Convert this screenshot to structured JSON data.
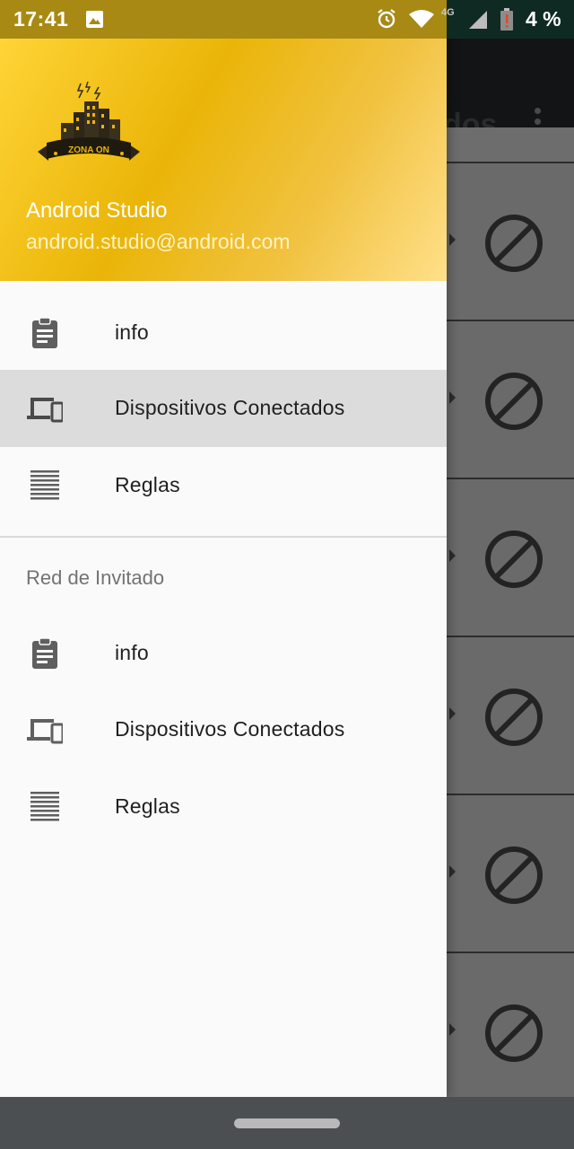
{
  "status_bar": {
    "time": "17:41",
    "network_label": "4G",
    "battery_text": "4 %",
    "icons": [
      "image-icon",
      "alarm-icon",
      "wifi-icon",
      "signal-icon",
      "battery-icon"
    ]
  },
  "background_app": {
    "title_fragment": "dos",
    "row_icon": "block-icon"
  },
  "drawer": {
    "header": {
      "logo_text": "ZONA ON",
      "name": "Android Studio",
      "email": "android.studio@android.com"
    },
    "main_items": [
      {
        "label": "info",
        "icon": "clipboard-icon"
      },
      {
        "label": "Dispositivos Conectados",
        "icon": "devices-icon"
      },
      {
        "label": "Reglas",
        "icon": "list-icon"
      }
    ],
    "guest_section": {
      "title": "Red de Invitado",
      "items": [
        {
          "label": "info",
          "icon": "clipboard-icon"
        },
        {
          "label": "Dispositivos Conectados",
          "icon": "devices-icon"
        },
        {
          "label": "Reglas",
          "icon": "list-icon"
        }
      ]
    }
  },
  "colors": {
    "header_gold": "#eab508",
    "active_item_bg": "#dcdcdc",
    "status_bar_left": "#a88913"
  }
}
